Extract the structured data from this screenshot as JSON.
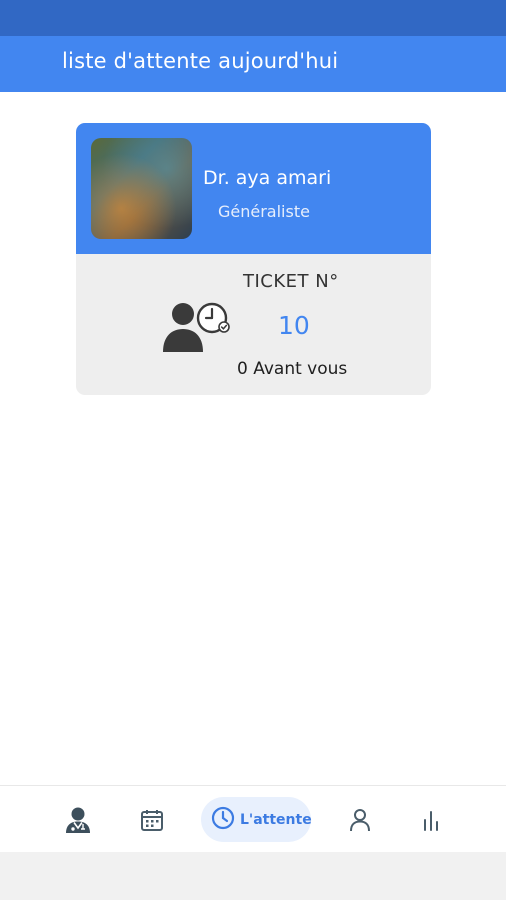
{
  "colors": {
    "status_bar": "#3168C4",
    "primary": "#4286F0",
    "card_background": "#EEEEEE",
    "active_tab_background": "#E8F0FD"
  },
  "header": {
    "title": "liste d'attente aujourd'hui"
  },
  "ticket_card": {
    "doctor_name": "Dr. aya amari",
    "specialty": "Généraliste",
    "ticket_label": "TICKET N°",
    "ticket_number": "10",
    "ahead_text": "0 Avant vous",
    "queue_icon": "person-clock-icon",
    "photo": "doctor-photo"
  },
  "bottom_nav": {
    "items": [
      {
        "icon": "doctor-icon",
        "label": ""
      },
      {
        "icon": "calendar-icon",
        "label": ""
      },
      {
        "icon": "clock-icon",
        "label": "L'attente",
        "active": true
      },
      {
        "icon": "person-icon",
        "label": ""
      },
      {
        "icon": "bar-chart-icon",
        "label": ""
      }
    ]
  }
}
